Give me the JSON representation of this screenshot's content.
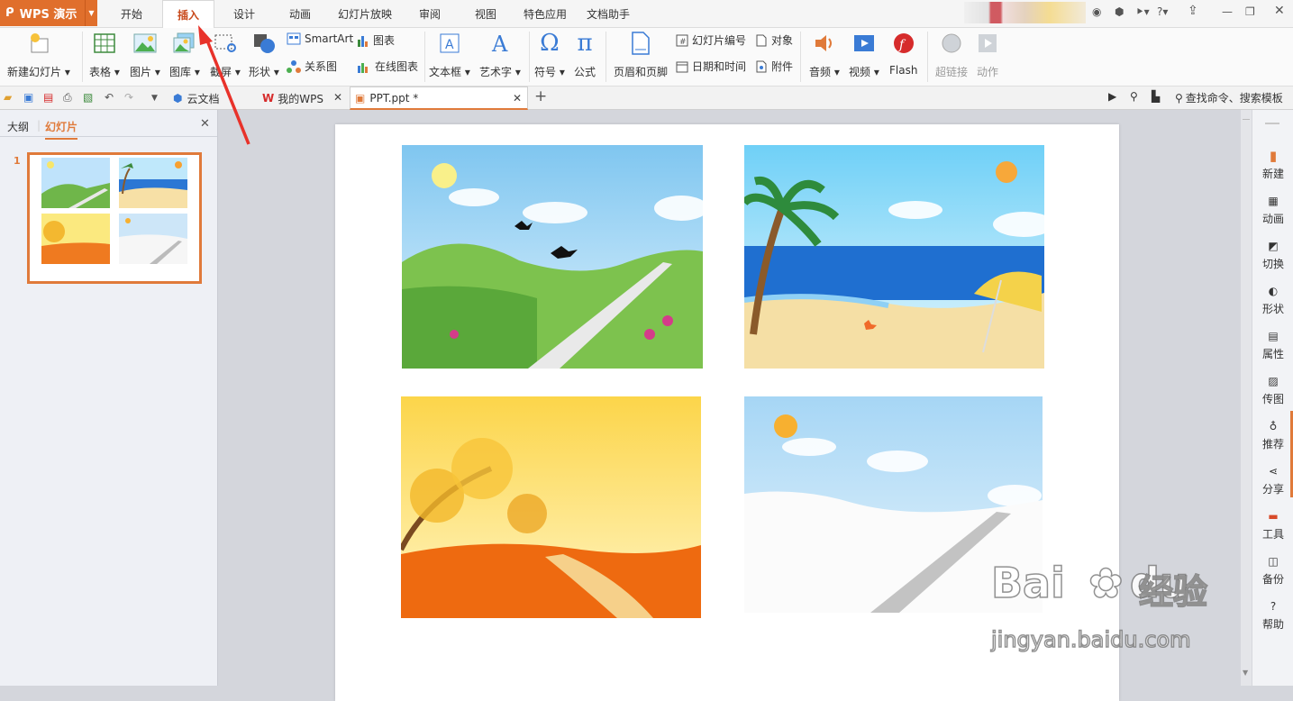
{
  "app": {
    "logo_text": "WPS 演示"
  },
  "menu": {
    "tabs": [
      "开始",
      "插入",
      "设计",
      "动画",
      "幻灯片放映",
      "审阅",
      "视图",
      "特色应用",
      "文档助手"
    ],
    "active": "插入"
  },
  "ribbon": {
    "new_slide": "新建幻灯片",
    "table": "表格",
    "picture": "图片",
    "gallery": "图库",
    "screenshot": "截屏",
    "shape": "形状",
    "smartart": "SmartArt",
    "chart": "图表",
    "relation": "关系图",
    "online_chart": "在线图表",
    "textbox": "文本框",
    "wordart": "艺术字",
    "symbol": "符号",
    "formula": "公式",
    "header_footer": "页眉和页脚",
    "slide_number": "幻灯片编号",
    "object": "对象",
    "datetime": "日期和时间",
    "attachment": "附件",
    "audio": "音频",
    "video": "视频",
    "flash": "Flash",
    "hyperlink": "超链接",
    "action": "动作"
  },
  "doc_tabs": [
    {
      "label": "云文档"
    },
    {
      "label": "我的WPS"
    },
    {
      "label": "PPT.ppt *"
    }
  ],
  "search": {
    "label": "查找命令、搜索模板"
  },
  "left_panel": {
    "tab_outline": "大纲",
    "tab_slides": "幻灯片",
    "slide_number": "1"
  },
  "sidebar": {
    "items": [
      "新建",
      "动画",
      "切换",
      "形状",
      "属性",
      "传图",
      "推荐",
      "分享",
      "工具",
      "备份",
      "帮助"
    ]
  },
  "watermark": {
    "brand": "Bai",
    "brand_du": "du",
    "cn": "经验",
    "url": "jingyan.baidu.com"
  },
  "colors": {
    "accent": "#e07a3a",
    "logo_bg": "#e06f2c",
    "active_tab_text": "#c8481a",
    "annotation_arrow": "#e8322a"
  }
}
